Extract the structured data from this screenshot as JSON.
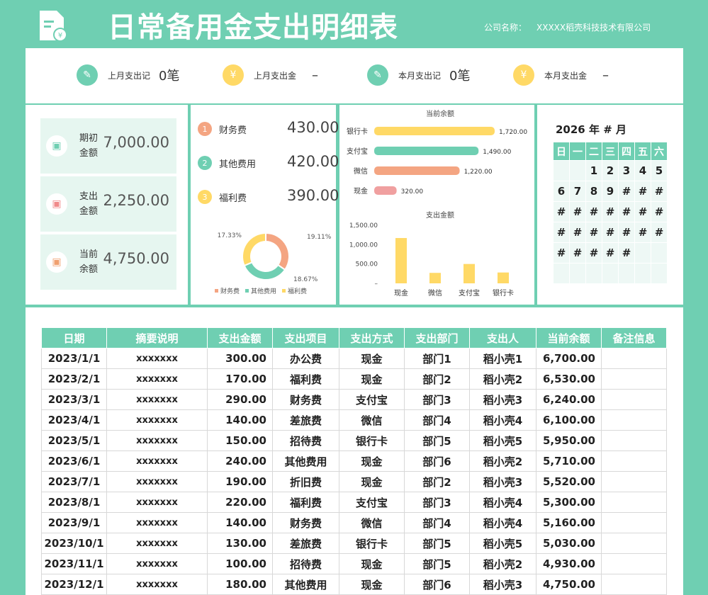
{
  "header": {
    "title": "日常备用金支出明细表",
    "company_label": "公司名称：",
    "company_value": "XXXXX稻壳科技技术有限公司"
  },
  "stats": [
    {
      "label": "上月支出记",
      "value": "0笔",
      "icon": "notepad-icon",
      "color": "#6fcfb2"
    },
    {
      "label": "上月支出金",
      "value": "–",
      "icon": "money-bag-icon",
      "color": "#ffd966"
    },
    {
      "label": "本月支出记",
      "value": "0笔",
      "icon": "notepad-icon",
      "color": "#6fcfb2"
    },
    {
      "label": "本月支出金",
      "value": "–",
      "icon": "money-bag-icon",
      "color": "#ffd966"
    }
  ],
  "balance_cards": [
    {
      "label": "期初金额",
      "value": "7,000.00",
      "icon": "wallet-icon",
      "color": "#6fcfb2"
    },
    {
      "label": "支出金额",
      "value": "2,250.00",
      "icon": "wallet-icon",
      "color": "#f08a8a"
    },
    {
      "label": "当前余额",
      "value": "4,750.00",
      "icon": "wallet-icon",
      "color": "#f0a070"
    }
  ],
  "ranking": [
    {
      "rank": "1",
      "label": "财务费",
      "value": "430.00",
      "color": "#f4a582"
    },
    {
      "rank": "2",
      "label": "其他费用",
      "value": "420.00",
      "color": "#6fcfb2"
    },
    {
      "rank": "3",
      "label": "福利费",
      "value": "390.00",
      "color": "#ffd966"
    }
  ],
  "colors": {
    "accent": "#6fcfb2",
    "yellow": "#ffd966",
    "orange": "#f4a582",
    "red": "#f0a0a0"
  },
  "chart_data": [
    {
      "type": "pie",
      "title": "",
      "series": [
        {
          "name": "财务费",
          "value": 19.11,
          "label": "19.11%",
          "color": "#f4a582"
        },
        {
          "name": "其他费用",
          "value": 18.67,
          "label": "18.67%",
          "color": "#6fcfb2"
        },
        {
          "name": "福利费",
          "value": 17.33,
          "label": "17.33%",
          "color": "#ffd966"
        }
      ],
      "legend": "bottom"
    },
    {
      "type": "bar",
      "orientation": "horizontal",
      "title": "当前余额",
      "categories": [
        "银行卡",
        "支付宝",
        "微信",
        "现金"
      ],
      "values": [
        1720,
        1490,
        1220,
        320
      ],
      "value_labels": [
        "1,720.00",
        "1,490.00",
        "1,220.00",
        "320.00"
      ],
      "colors": [
        "#ffd966",
        "#6fcfb2",
        "#f4a582",
        "#f0a0a0"
      ]
    },
    {
      "type": "bar",
      "title": "支出金额",
      "categories": [
        "现金",
        "微信",
        "支付宝",
        "银行卡"
      ],
      "values": [
        1170,
        270,
        500,
        280
      ],
      "yticks": [
        "1,500.00",
        "1,000.00",
        "500.00",
        "–"
      ],
      "ylim": [
        0,
        1500
      ],
      "color": "#ffd966"
    }
  ],
  "calendar": {
    "year": "2026",
    "year_suffix": "年",
    "month": "#",
    "month_suffix": "月",
    "weekdays": [
      "日",
      "一",
      "二",
      "三",
      "四",
      "五",
      "六"
    ],
    "rows": [
      [
        "",
        "",
        "1",
        "2",
        "3",
        "4",
        "5"
      ],
      [
        "6",
        "7",
        "8",
        "9",
        "#",
        "#",
        "#"
      ],
      [
        "#",
        "#",
        "#",
        "#",
        "#",
        "#",
        "#"
      ],
      [
        "#",
        "#",
        "#",
        "#",
        "#",
        "#",
        "#"
      ],
      [
        "#",
        "#",
        "#",
        "#",
        "#",
        "",
        ""
      ],
      [
        "",
        "",
        "",
        "",
        "",
        "",
        ""
      ]
    ]
  },
  "table": {
    "headers": [
      "日期",
      "摘要说明",
      "支出金额",
      "支出项目",
      "支出方式",
      "支出部门",
      "支出人",
      "当前余额",
      "备注信息"
    ],
    "rows": [
      [
        "2023/1/1",
        "xxxxxxx",
        "300.00",
        "办公费",
        "现金",
        "部门1",
        "稻小壳1",
        "6,700.00",
        ""
      ],
      [
        "2023/2/1",
        "xxxxxxx",
        "170.00",
        "福利费",
        "现金",
        "部门2",
        "稻小壳2",
        "6,530.00",
        ""
      ],
      [
        "2023/3/1",
        "xxxxxxx",
        "290.00",
        "财务费",
        "支付宝",
        "部门3",
        "稻小壳3",
        "6,240.00",
        ""
      ],
      [
        "2023/4/1",
        "xxxxxxx",
        "140.00",
        "差旅费",
        "微信",
        "部门4",
        "稻小壳4",
        "6,100.00",
        ""
      ],
      [
        "2023/5/1",
        "xxxxxxx",
        "150.00",
        "招待费",
        "银行卡",
        "部门5",
        "稻小壳5",
        "5,950.00",
        ""
      ],
      [
        "2023/6/1",
        "xxxxxxx",
        "240.00",
        "其他费用",
        "现金",
        "部门6",
        "稻小壳2",
        "5,710.00",
        ""
      ],
      [
        "2023/7/1",
        "xxxxxxx",
        "190.00",
        "折旧费",
        "现金",
        "部门2",
        "稻小壳3",
        "5,520.00",
        ""
      ],
      [
        "2023/8/1",
        "xxxxxxx",
        "220.00",
        "福利费",
        "支付宝",
        "部门3",
        "稻小壳4",
        "5,300.00",
        ""
      ],
      [
        "2023/9/1",
        "xxxxxxx",
        "140.00",
        "财务费",
        "微信",
        "部门4",
        "稻小壳4",
        "5,160.00",
        ""
      ],
      [
        "2023/10/1",
        "xxxxxxx",
        "130.00",
        "差旅费",
        "银行卡",
        "部门5",
        "稻小壳5",
        "5,030.00",
        ""
      ],
      [
        "2023/11/1",
        "xxxxxxx",
        "100.00",
        "招待费",
        "现金",
        "部门5",
        "稻小壳2",
        "4,930.00",
        ""
      ],
      [
        "2023/12/1",
        "xxxxxxx",
        "180.00",
        "其他费用",
        "现金",
        "部门6",
        "稻小壳3",
        "4,750.00",
        ""
      ]
    ]
  }
}
